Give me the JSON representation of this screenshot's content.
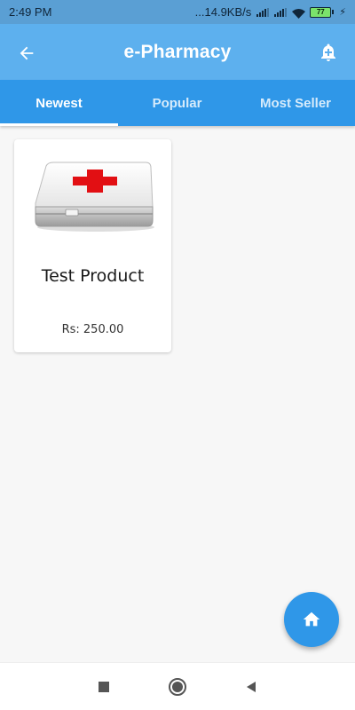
{
  "status_bar": {
    "time": "2:49 PM",
    "network_speed": "...14.9KB/s",
    "battery_level": "77",
    "icons": [
      "signal-icon",
      "signal-icon",
      "wifi-icon",
      "battery-icon",
      "charging-icon"
    ]
  },
  "app_bar": {
    "title": "e-Pharmacy",
    "back_icon": "arrow-left-icon",
    "action_icon": "bell-plus-icon",
    "background": "#5db0ee"
  },
  "tabs": [
    {
      "label": "Newest",
      "selected": true
    },
    {
      "label": "Popular",
      "selected": false
    },
    {
      "label": "Most Seller",
      "selected": false
    }
  ],
  "products": [
    {
      "name": "Test Product",
      "price": "Rs: 250.00",
      "image": "first-aid-kit"
    }
  ],
  "fab": {
    "icon": "home-icon",
    "color": "#2f97e8"
  },
  "nav_bar": {
    "buttons": [
      "recent-apps-icon",
      "home-circle-icon",
      "back-triangle-icon"
    ]
  },
  "colors": {
    "accent": "#2f97e8",
    "toolbar": "#5db0ee",
    "status_bar": "#5a9fd4",
    "background": "#f7f7f7"
  }
}
